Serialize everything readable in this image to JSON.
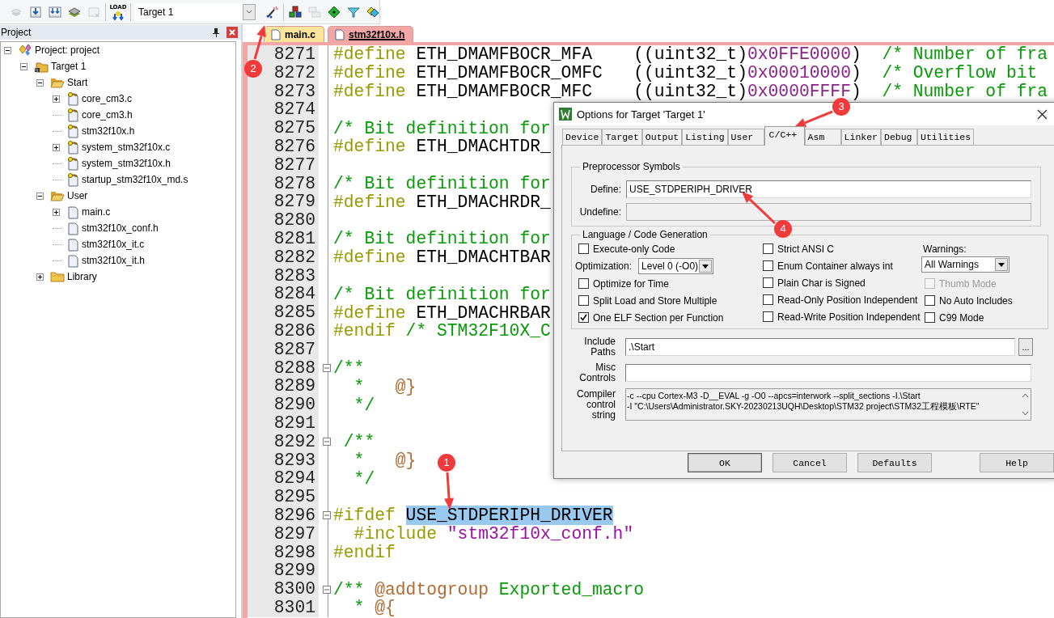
{
  "toolbar": {
    "groups": [
      [
        {
          "kind": "button",
          "disabled": true
        },
        {
          "kind": "button",
          "disabled": false
        },
        {
          "kind": "button",
          "disabled": false
        },
        {
          "kind": "button",
          "disabled": false
        },
        {
          "kind": "button",
          "disabled": true
        }
      ],
      [
        {
          "kind": "button",
          "label": "LOAD",
          "disabled": false
        }
      ],
      [
        {
          "kind": "select",
          "value": "Target 1"
        },
        {
          "kind": "button",
          "disabled": false
        }
      ],
      [
        {
          "kind": "button",
          "disabled": false
        },
        {
          "kind": "button",
          "disabled": true
        },
        {
          "kind": "button",
          "disabled": false
        },
        {
          "kind": "button",
          "disabled": false
        },
        {
          "kind": "button",
          "disabled": false
        }
      ]
    ]
  },
  "project_panel": {
    "title": "Project",
    "tree": [
      {
        "label": "Project: project",
        "kind": "project",
        "expanded": true,
        "children": [
          {
            "label": "Target 1",
            "kind": "target",
            "expanded": true,
            "children": [
              {
                "label": "Start",
                "kind": "folder",
                "expanded": true,
                "children": [
                  {
                    "label": "core_cm3.c",
                    "kind": "file",
                    "read_only": true,
                    "expanded": false
                  },
                  {
                    "label": "core_cm3.h",
                    "kind": "file",
                    "read_only": true
                  },
                  {
                    "label": "stm32f10x.h",
                    "kind": "file",
                    "read_only": true
                  },
                  {
                    "label": "system_stm32f10x.c",
                    "kind": "file",
                    "read_only": true,
                    "expanded": false
                  },
                  {
                    "label": "system_stm32f10x.h",
                    "kind": "file",
                    "read_only": true
                  },
                  {
                    "label": "startup_stm32f10x_md.s",
                    "kind": "file",
                    "read_only": true
                  }
                ]
              },
              {
                "label": "User",
                "kind": "folder",
                "expanded": true,
                "children": [
                  {
                    "label": "main.c",
                    "kind": "file",
                    "read_only": false,
                    "expanded": false
                  },
                  {
                    "label": "stm32f10x_conf.h",
                    "kind": "file",
                    "read_only": false
                  },
                  {
                    "label": "stm32f10x_it.c",
                    "kind": "file",
                    "read_only": false
                  },
                  {
                    "label": "stm32f10x_it.h",
                    "kind": "file",
                    "read_only": false
                  }
                ]
              },
              {
                "label": "Library",
                "kind": "folder",
                "expanded": false
              }
            ]
          }
        ]
      }
    ]
  },
  "editor_tabs": [
    {
      "label": "main.c",
      "selected": false
    },
    {
      "label": "stm32f10x.h",
      "selected": true
    }
  ],
  "editor": {
    "lines": [
      {
        "number": "8271",
        "tokens": [
          {
            "kind": "directive",
            "text": "#define"
          },
          {
            "kind": "plain",
            "text": " ETH_DMAMFBOCR_MFA    ((uint32_t)"
          },
          {
            "kind": "number",
            "text": "0x0FFE0000"
          },
          {
            "kind": "plain",
            "text": ")  "
          },
          {
            "kind": "comment",
            "text": "/* Number of fra"
          }
        ]
      },
      {
        "number": "8272",
        "tokens": [
          {
            "kind": "directive",
            "text": "#define"
          },
          {
            "kind": "plain",
            "text": " ETH_DMAMFBOCR_OMFC   ((uint32_t)"
          },
          {
            "kind": "number",
            "text": "0x00010000"
          },
          {
            "kind": "plain",
            "text": ")  "
          },
          {
            "kind": "comment",
            "text": "/* Overflow bit"
          }
        ]
      },
      {
        "number": "8273",
        "tokens": [
          {
            "kind": "directive",
            "text": "#define"
          },
          {
            "kind": "plain",
            "text": " ETH_DMAMFBOCR_MFC    ((uint32_t)"
          },
          {
            "kind": "number",
            "text": "0x0000FFFF"
          },
          {
            "kind": "plain",
            "text": ")  "
          },
          {
            "kind": "comment",
            "text": "/* Number of fra"
          }
        ]
      },
      {
        "number": "8274"
      },
      {
        "number": "8275",
        "tokens": [
          {
            "kind": "comment",
            "text": "/* Bit definition for"
          }
        ]
      },
      {
        "number": "8276",
        "tokens": [
          {
            "kind": "directive",
            "text": "#define"
          },
          {
            "kind": "plain",
            "text": " ETH_DMACHTDR_"
          }
        ]
      },
      {
        "number": "8277"
      },
      {
        "number": "8278",
        "tokens": [
          {
            "kind": "comment",
            "text": "/* Bit definition for"
          }
        ]
      },
      {
        "number": "8279",
        "tokens": [
          {
            "kind": "directive",
            "text": "#define"
          },
          {
            "kind": "plain",
            "text": " ETH_DMACHRDR_"
          }
        ]
      },
      {
        "number": "8280"
      },
      {
        "number": "8281",
        "tokens": [
          {
            "kind": "comment",
            "text": "/* Bit definition for"
          }
        ]
      },
      {
        "number": "8282",
        "tokens": [
          {
            "kind": "directive",
            "text": "#define"
          },
          {
            "kind": "plain",
            "text": " ETH_DMACHTBAR"
          }
        ]
      },
      {
        "number": "8283"
      },
      {
        "number": "8284",
        "tokens": [
          {
            "kind": "comment",
            "text": "/* Bit definition for"
          }
        ]
      },
      {
        "number": "8285",
        "tokens": [
          {
            "kind": "directive",
            "text": "#define"
          },
          {
            "kind": "plain",
            "text": " ETH_DMACHRBAR"
          }
        ]
      },
      {
        "number": "8286",
        "tokens": [
          {
            "kind": "directive",
            "text": "#endif "
          },
          {
            "kind": "comment",
            "text": "/* STM32F10X_C"
          }
        ]
      },
      {
        "number": "8287"
      },
      {
        "number": "8288",
        "folded": false,
        "tokens": [
          {
            "kind": "comment",
            "text": "/**"
          }
        ]
      },
      {
        "number": "8289",
        "tokens": [
          {
            "kind": "comment",
            "text": "  *   "
          },
          {
            "kind": "tag",
            "text": "@}"
          }
        ]
      },
      {
        "number": "8290",
        "tokens": [
          {
            "kind": "comment",
            "text": "  */"
          }
        ]
      },
      {
        "number": "8291"
      },
      {
        "number": "8292",
        "folded": false,
        "tokens": [
          {
            "kind": "comment",
            "text": " /**"
          }
        ]
      },
      {
        "number": "8293",
        "tokens": [
          {
            "kind": "comment",
            "text": "  *   "
          },
          {
            "kind": "tag",
            "text": "@}"
          }
        ]
      },
      {
        "number": "8294",
        "tokens": [
          {
            "kind": "comment",
            "text": "  */"
          }
        ]
      },
      {
        "number": "8295"
      },
      {
        "number": "8296",
        "folded": false,
        "tokens": [
          {
            "kind": "directive",
            "text": "#ifdef "
          },
          {
            "kind": "selection",
            "text": "USE_STDPERIPH_DRIVER"
          }
        ]
      },
      {
        "number": "8297",
        "tokens": [
          {
            "kind": "directive",
            "text": "  #include "
          },
          {
            "kind": "string",
            "text": "\"stm32f10x_conf.h\""
          }
        ]
      },
      {
        "number": "8298",
        "tokens": [
          {
            "kind": "directive",
            "text": "#endif"
          }
        ]
      },
      {
        "number": "8299"
      },
      {
        "number": "8300",
        "folded": false,
        "tokens": [
          {
            "kind": "comment",
            "text": "/** "
          },
          {
            "kind": "tag",
            "text": "@addtogroup"
          },
          {
            "kind": "comment",
            "text": " Exported_macro"
          }
        ]
      },
      {
        "number": "8301",
        "tokens": [
          {
            "kind": "comment",
            "text": "  * "
          },
          {
            "kind": "tag",
            "text": "@{"
          }
        ]
      }
    ]
  },
  "dialog": {
    "title": "Options for Target 'Target 1'",
    "tabs": [
      {
        "label": "Device",
        "selected": false
      },
      {
        "label": "Target",
        "selected": false
      },
      {
        "label": "Output",
        "selected": false
      },
      {
        "label": "Listing",
        "selected": false
      },
      {
        "label": "User",
        "selected": false
      },
      {
        "label": "C/C++",
        "selected": true
      },
      {
        "label": "Asm",
        "selected": false
      },
      {
        "label": "Linker",
        "selected": false
      },
      {
        "label": "Debug",
        "selected": false
      },
      {
        "label": "Utilities",
        "selected": false
      }
    ],
    "preprocessor": {
      "title": "Preprocessor Symbols",
      "fields": [
        {
          "label": "Define:",
          "value": "USE_STDPERIPH_DRIVER",
          "disabled": false
        },
        {
          "label": "Undefine:",
          "disabled": true
        }
      ]
    },
    "language": {
      "title": "Language / Code Generation",
      "columns": [
        [
          {
            "kind": "checkbox",
            "label": "Execute-only Code",
            "checked": false,
            "disabled": false
          },
          {
            "kind": "select",
            "label": "Optimization:",
            "value": "Level 0 (-O0)"
          },
          {
            "kind": "checkbox",
            "label": "Optimize for Time",
            "checked": false,
            "disabled": false
          },
          {
            "kind": "checkbox",
            "label": "Split Load and Store Multiple",
            "checked": false,
            "disabled": false
          },
          {
            "kind": "checkbox",
            "label": "One ELF Section per Function",
            "checked": true,
            "disabled": false
          }
        ],
        [
          {
            "kind": "checkbox",
            "label": "Strict ANSI C",
            "checked": false,
            "disabled": false
          },
          {
            "kind": "checkbox",
            "label": "Enum Container always int",
            "checked": false,
            "disabled": false
          },
          {
            "kind": "checkbox",
            "label": "Plain Char is Signed",
            "checked": false,
            "disabled": false
          },
          {
            "kind": "checkbox",
            "label": "Read-Only Position Independent",
            "checked": false,
            "disabled": false
          },
          {
            "kind": "checkbox",
            "label": "Read-Write Position Independent",
            "checked": false,
            "disabled": false
          }
        ],
        [
          {
            "kind": "stacked_select",
            "label": "Warnings:",
            "value": "All Warnings"
          },
          {
            "kind": "checkbox",
            "label": "Thumb Mode",
            "checked": false,
            "disabled": true
          },
          {
            "kind": "checkbox",
            "label": "No Auto Includes",
            "checked": false,
            "disabled": false
          },
          {
            "kind": "checkbox",
            "label": "C99 Mode",
            "checked": false,
            "disabled": false
          }
        ]
      ]
    },
    "include_paths": {
      "label": "Include Paths",
      "value": ".\\Start",
      "browse": "..."
    },
    "misc_controls": {
      "label": "Misc Controls"
    },
    "compiler_string": {
      "label": "Compiler control string",
      "lines": [
        "-c --cpu Cortex-M3 -D__EVAL -g -O0 --apcs=interwork --split_sections -I.\\Start",
        "-I \"C:\\Users\\Administrator.SKY-20230213UQH\\Desktop\\STM32 project\\STM32工程模板\\RTE\""
      ]
    },
    "buttons": [
      "OK",
      "Cancel",
      "Defaults",
      "Help"
    ]
  },
  "annotations": [
    {
      "number": "1"
    },
    {
      "number": "2"
    },
    {
      "number": "3"
    },
    {
      "number": "4"
    }
  ]
}
